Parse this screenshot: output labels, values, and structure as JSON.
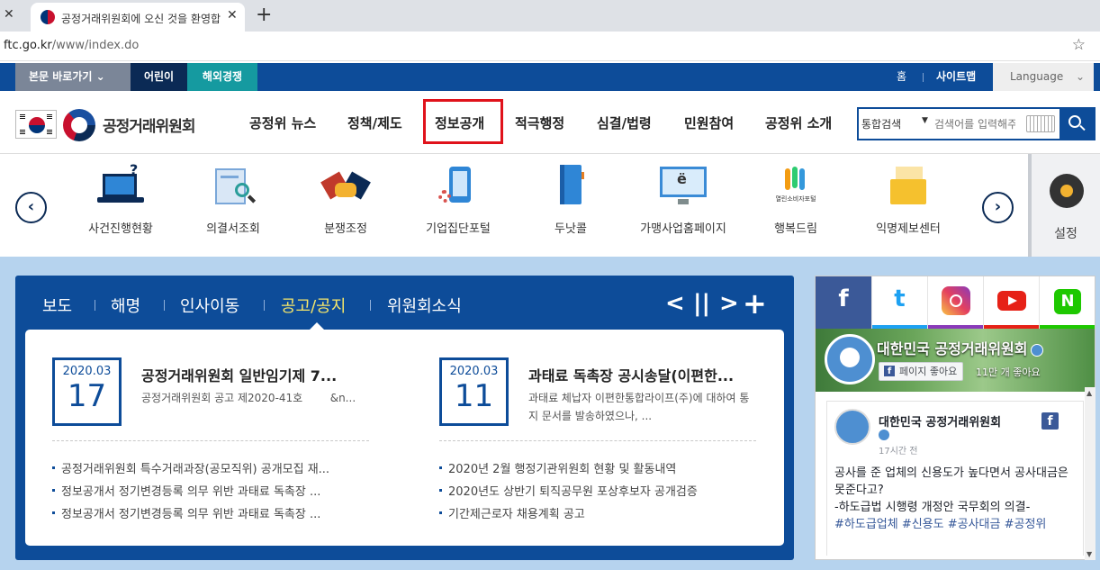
{
  "browser": {
    "tab_title": "공정거래위원회에 오신 것을 환영합니다",
    "url_host": "ftc.go.kr",
    "url_path": "/www/index.do"
  },
  "utility": {
    "skip_label": "본문 바로가기",
    "kids_label": "어린이",
    "overseas_label": "해외경쟁",
    "home_label": "홈",
    "sitemap_label": "사이트맵",
    "language_label": "Language"
  },
  "header": {
    "logo_text": "공정거래위원회",
    "nav": [
      "공정위 뉴스",
      "정책/제도",
      "정보공개",
      "적극행정",
      "심결/법령",
      "민원참여",
      "공정위 소개"
    ],
    "active_nav_index": 2
  },
  "search": {
    "scope": "통합검색",
    "placeholder": "검색어를 입력해주세요"
  },
  "quick_menu": {
    "items": [
      "사건진행현황",
      "의결서조회",
      "분쟁조정",
      "기업집단포털",
      "두낫콜",
      "가맹사업홈페이지",
      "행복드림",
      "익명제보센터"
    ],
    "happy_dream_caption": "열린소비자포털",
    "settings_label": "설정"
  },
  "news": {
    "tabs": [
      "보도",
      "해명",
      "인사이동",
      "공고/공지",
      "위원회소식"
    ],
    "active_tab_index": 3,
    "featured": [
      {
        "year_month": "2020.03",
        "day": "17",
        "title": "공정거래위원회 일반임기제 7...",
        "description": "공정거래위원회 공고 제2020-41호        &n..."
      },
      {
        "year_month": "2020.03",
        "day": "11",
        "title": "과태료 독촉장 공시송달(이편한...",
        "description": "과태료 체납자 이편한통합라이프(주)에 대하여 통지 문서를 발송하였으나, ..."
      }
    ],
    "list_left": [
      "공정거래위원회 특수거래과장(공모직위) 공개모집 재...",
      "정보공개서 정기변경등록 의무 위반 과태료 독촉장 ...",
      "정보공개서 정기변경등록 의무 위반 과태료 독촉장 ..."
    ],
    "list_right": [
      "2020년 2월 행정기관위원회 현황 및 활동내역",
      "2020년도 상반기 퇴직공무원 포상후보자 공개검증",
      "기간제근로자 채용계획 공고"
    ]
  },
  "sns": {
    "page_name": "대한민국 공정거래위원회",
    "like_button": "페이지 좋아요",
    "likes_count": "11만 개 좋아요",
    "post_author": "대한민국 공정거래위원회",
    "post_time": "17시간 전",
    "post_text": "공사를 준 업체의 신용도가 높다면서 공사대금은 못준다고?\n-하도급법 시행령 개정안 국무회의 의결-",
    "post_tags": "#하도급업체 #신용도 #공사대금 #공정위",
    "colors": {
      "facebook": "#3b5998",
      "twitter": "#1da1f2",
      "instagram": "#e4405f",
      "youtube": "#e62117",
      "naver": "#1ec800"
    }
  },
  "colors": {
    "primary": "#0d4c99",
    "navy": "#0b2a55",
    "teal": "#159aa0",
    "highlight_border": "#e0121b",
    "active_tab_text": "#f5e66a",
    "background": "#b6d3ee"
  }
}
